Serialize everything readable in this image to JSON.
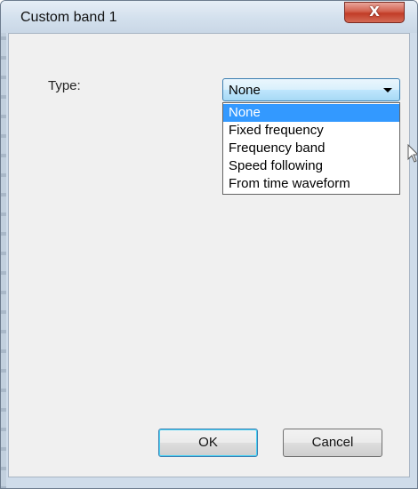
{
  "window": {
    "title": "Custom band 1",
    "close_glyph": "X"
  },
  "form": {
    "type_label": "Type:",
    "type_selected": "None",
    "options": [
      {
        "label": "None",
        "selected": true
      },
      {
        "label": "Fixed frequency",
        "selected": false
      },
      {
        "label": "Frequency band",
        "selected": false
      },
      {
        "label": "Speed following",
        "selected": false
      },
      {
        "label": "From time waveform",
        "selected": false
      }
    ]
  },
  "buttons": {
    "ok": "OK",
    "cancel": "Cancel"
  },
  "colors": {
    "highlight": "#3399ff",
    "close_button": "#c13c27",
    "combo_border": "#3c7fb1"
  }
}
